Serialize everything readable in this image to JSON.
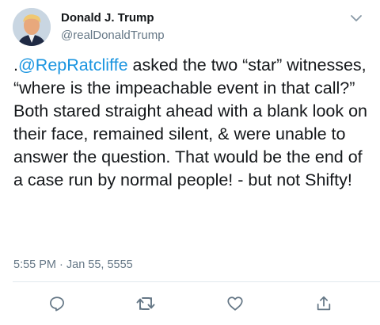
{
  "tweet": {
    "author_name": "Donald J. Trump",
    "author_handle": "@realDonaldTrump",
    "text_prefix": ".",
    "mention": "@RepRatcliffe",
    "text_body": " asked the two “star” witnesses, “where is the impeachable event in that call?” Both stared straight ahead with a blank look on their face, remained silent, & were unable to answer the question. That would be the end of a case run by normal people! - but not Shifty!",
    "timestamp": "5:55 PM · Jan 55, 5555"
  },
  "icons": {
    "menu": "chevron-down-icon",
    "reply": "reply-icon",
    "retweet": "retweet-icon",
    "like": "like-icon",
    "share": "share-icon"
  },
  "colors": {
    "mention": "#1b95e0",
    "secondary_text": "#657786",
    "icon": "#657786",
    "divider": "#e1e8ed"
  }
}
